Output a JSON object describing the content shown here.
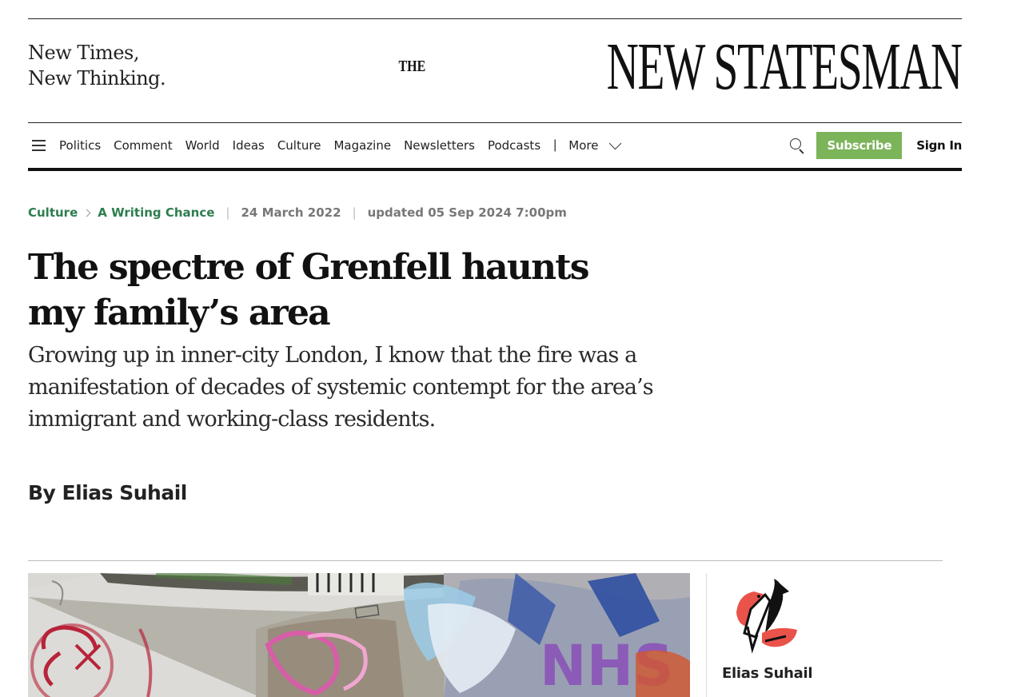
{
  "header": {
    "tagline_line1": "New Times,",
    "tagline_line2": "New Thinking.",
    "logo_the": "THE",
    "logo_main": "NEW STATESMAN"
  },
  "nav": {
    "items": [
      "Politics",
      "Comment",
      "World",
      "Ideas",
      "Culture",
      "Magazine",
      "Newsletters",
      "Podcasts"
    ],
    "separator": "|",
    "more_label": "More",
    "subscribe_label": "Subscribe",
    "signin_label": "Sign In"
  },
  "article": {
    "breadcrumb": [
      "Culture",
      "A Writing Chance"
    ],
    "date": "24 March 2022",
    "meta_separator": "|",
    "updated": "updated 05 Sep 2024 7:00pm",
    "headline": "The spectre of Grenfell haunts my family’s area",
    "standfirst": "Growing up in inner-city London, I know that the fire was a manifestation of decades of systemic contempt for the area’s immigrant and working-class residents.",
    "byline": "By Elias Suhail"
  },
  "author_card": {
    "name": "Elias Suhail"
  },
  "colors": {
    "accent_green": "#2e7d4f",
    "subscribe_bg": "#7cb45a",
    "illustration_red": "#e9534a"
  }
}
